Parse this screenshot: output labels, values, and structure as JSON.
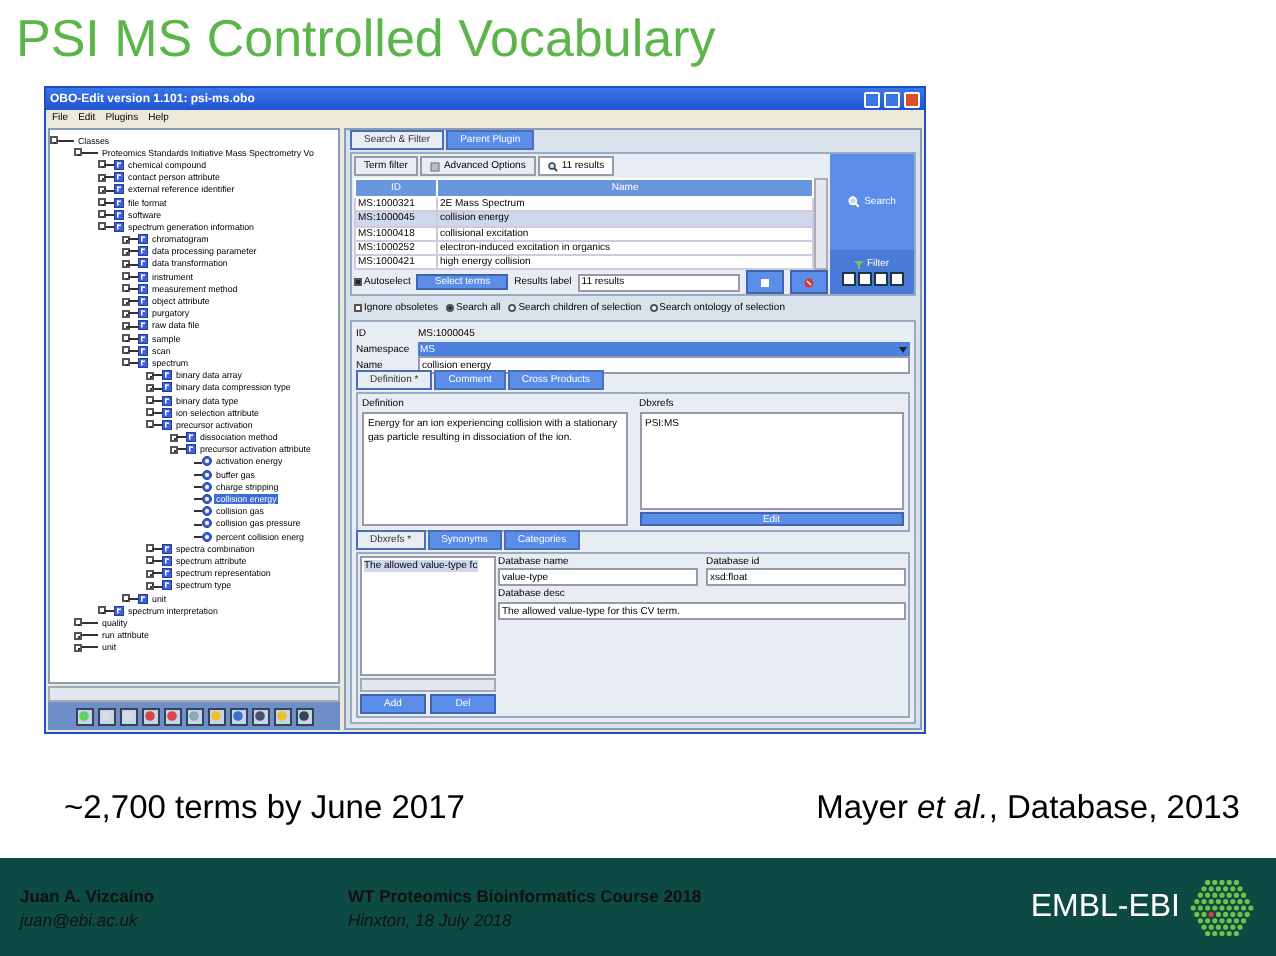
{
  "slide_title": "PSI MS Controlled Vocabulary",
  "window": {
    "title": "OBO-Edit version 1.101: psi-ms.obo",
    "menu": [
      "File",
      "Edit",
      "Plugins",
      "Help"
    ],
    "tree": [
      {
        "label": "Classes",
        "kind": "plain",
        "expanded": true,
        "selected": false,
        "children": [
          {
            "label": "Proteomics Standards Initiative Mass Spectrometry Vo",
            "kind": "plain",
            "expanded": true,
            "selected": false,
            "children": [
              {
                "label": "chemical compound",
                "kind": "class",
                "expanded": false,
                "selected": false
              },
              {
                "label": "contact person attribute",
                "kind": "class",
                "expanded": false,
                "selected": false
              },
              {
                "label": "external reference identifier",
                "kind": "class",
                "expanded": false,
                "selected": false
              },
              {
                "label": "file format",
                "kind": "class",
                "expanded": false,
                "selected": false
              },
              {
                "label": "software",
                "kind": "class",
                "expanded": false,
                "selected": false
              },
              {
                "label": "spectrum generation information",
                "kind": "class",
                "expanded": true,
                "selected": false,
                "children": [
                  {
                    "label": "chromatogram",
                    "kind": "class",
                    "expanded": false,
                    "selected": false
                  },
                  {
                    "label": "data processing parameter",
                    "kind": "class",
                    "expanded": false,
                    "selected": false
                  },
                  {
                    "label": "data transformation",
                    "kind": "class",
                    "expanded": false,
                    "selected": false
                  },
                  {
                    "label": "instrument",
                    "kind": "class",
                    "expanded": false,
                    "selected": false
                  },
                  {
                    "label": "measurement method",
                    "kind": "class",
                    "expanded": false,
                    "selected": false
                  },
                  {
                    "label": "object attribute",
                    "kind": "class",
                    "expanded": false,
                    "selected": false
                  },
                  {
                    "label": "purgatory",
                    "kind": "class",
                    "expanded": false,
                    "selected": false
                  },
                  {
                    "label": "raw data file",
                    "kind": "class",
                    "expanded": false,
                    "selected": false
                  },
                  {
                    "label": "sample",
                    "kind": "class",
                    "expanded": false,
                    "selected": false
                  },
                  {
                    "label": "scan",
                    "kind": "class",
                    "expanded": false,
                    "selected": false
                  },
                  {
                    "label": "spectrum",
                    "kind": "class",
                    "expanded": true,
                    "selected": false,
                    "children": [
                      {
                        "label": "binary data array",
                        "kind": "class",
                        "expanded": false,
                        "selected": false
                      },
                      {
                        "label": "binary data compression type",
                        "kind": "class",
                        "expanded": false,
                        "selected": false
                      },
                      {
                        "label": "binary data type",
                        "kind": "class",
                        "expanded": false,
                        "selected": false
                      },
                      {
                        "label": "ion selection attribute",
                        "kind": "class",
                        "expanded": false,
                        "selected": false
                      },
                      {
                        "label": "precursor activation",
                        "kind": "class",
                        "expanded": true,
                        "selected": false,
                        "children": [
                          {
                            "label": "dissociation method",
                            "kind": "class",
                            "expanded": false,
                            "selected": false
                          },
                          {
                            "label": "precursor activation attribute",
                            "kind": "class",
                            "expanded": true,
                            "selected": false,
                            "children": [
                              {
                                "label": "activation energy",
                                "kind": "term",
                                "selected": false
                              },
                              {
                                "label": "buffer gas",
                                "kind": "term",
                                "selected": false
                              },
                              {
                                "label": "charge stripping",
                                "kind": "term",
                                "selected": false
                              },
                              {
                                "label": "collision energy",
                                "kind": "term",
                                "selected": true
                              },
                              {
                                "label": "collision gas",
                                "kind": "term",
                                "selected": false
                              },
                              {
                                "label": "collision gas pressure",
                                "kind": "term",
                                "selected": false
                              },
                              {
                                "label": "percent collision energ",
                                "kind": "term",
                                "selected": false
                              }
                            ]
                          }
                        ]
                      },
                      {
                        "label": "spectra combination",
                        "kind": "class",
                        "expanded": false,
                        "selected": false
                      },
                      {
                        "label": "spectrum attribute",
                        "kind": "class",
                        "expanded": false,
                        "selected": false
                      },
                      {
                        "label": "spectrum representation",
                        "kind": "class",
                        "expanded": false,
                        "selected": false
                      },
                      {
                        "label": "spectrum type",
                        "kind": "class",
                        "expanded": false,
                        "selected": false
                      }
                    ]
                  },
                  {
                    "label": "unit",
                    "kind": "class",
                    "expanded": false,
                    "selected": false
                  }
                ]
              },
              {
                "label": "spectrum interpretation",
                "kind": "class",
                "expanded": false,
                "selected": false
              }
            ]
          },
          {
            "label": "quality",
            "kind": "plain",
            "expanded": true,
            "selected": false
          },
          {
            "label": "run attribute",
            "kind": "plain",
            "expanded": true,
            "selected": false
          },
          {
            "label": "unit",
            "kind": "plain",
            "expanded": true,
            "selected": false
          }
        ]
      }
    ],
    "search": {
      "tabs": [
        {
          "label": "Search & Filter",
          "selected": true
        },
        {
          "label": "Parent Plugin",
          "selected": false
        }
      ],
      "subtabs": [
        {
          "label": "Term filter",
          "kind": "plain",
          "selected": false
        },
        {
          "label": "Advanced Options",
          "kind": "options",
          "selected": false
        },
        {
          "label": "11 results",
          "kind": "results",
          "selected": true
        }
      ],
      "columns": [
        "ID",
        "Name"
      ],
      "rows": [
        {
          "id": "MS:1000321",
          "name": "2E Mass Spectrum",
          "selected": false
        },
        {
          "id": "MS:1000045",
          "name": "collision energy",
          "selected": true
        },
        {
          "id": "MS:1000418",
          "name": "collisional excitation",
          "selected": false
        },
        {
          "id": "MS:1000252",
          "name": "electron-induced excitation in organics",
          "selected": false
        },
        {
          "id": "MS:1000421",
          "name": "high energy collision",
          "selected": false
        }
      ],
      "search_button": "Search",
      "filter_button": "Filter",
      "autoselect": {
        "label": "Autoselect",
        "checked": true
      },
      "select_terms": "Select terms",
      "results_label": "Results label",
      "results_value": "11 results",
      "ignore_obsoletes": {
        "label": "Ignore obsoletes",
        "checked": false
      },
      "scopes": [
        {
          "label": "Search all",
          "selected": true
        },
        {
          "label": "Search children of selection",
          "selected": false
        },
        {
          "label": "Search ontology of selection",
          "selected": false
        }
      ]
    },
    "term": {
      "id_label": "ID",
      "id": "MS:1000045",
      "namespace_label": "Namespace",
      "namespace": "MS",
      "name_label": "Name",
      "name": "collision energy",
      "tabs": [
        {
          "label": "Definition *",
          "selected": true
        },
        {
          "label": "Comment",
          "selected": false
        },
        {
          "label": "Cross Products",
          "selected": false
        }
      ],
      "definition_label": "Definition",
      "definition": "Energy for an ion experiencing collision with a stationary gas particle resulting in dissociation of the ion.",
      "dbxrefs_label": "Dbxrefs",
      "dbxrefs": "PSI:MS",
      "edit_button": "Edit",
      "tabs2": [
        {
          "label": "Dbxrefs *",
          "selected": true
        },
        {
          "label": "Synonyms",
          "selected": false
        },
        {
          "label": "Categories",
          "selected": false
        }
      ],
      "xref_list": [
        "The allowed value-type fc"
      ],
      "add_button": "Add",
      "del_button": "Del",
      "db_name_label": "Database name",
      "db_name": "value-type",
      "db_id_label": "Database id",
      "db_id": "xsd:float",
      "db_desc_label": "Database desc",
      "db_desc": "The allowed value-type for this CV term."
    }
  },
  "caption_left": "~2,700 terms by June 2017",
  "caption_right": "Mayer *et al.*, Database, 2013",
  "footer": {
    "author": "Juan A. Vizcaíno",
    "email": "juan@ebi.ac.uk",
    "course": "WT Proteomics Bioinformatics Course 2018",
    "place": "Hinxton, 18 July 2018",
    "logo": "EMBL-EBI"
  }
}
